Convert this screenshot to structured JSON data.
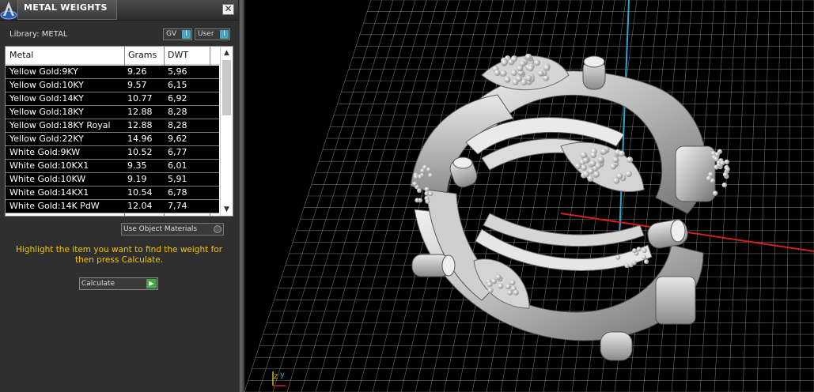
{
  "panel": {
    "title": "METAL WEIGHTS",
    "close_glyph": "✕",
    "library_label": "Library: METAL",
    "gv_label": "GV",
    "user_label": "User",
    "toggle_glyph": "I",
    "columns": [
      "Metal",
      "Grams",
      "DWT"
    ],
    "rows": [
      {
        "metal": "Yellow Gold:9KY",
        "grams": "9.26",
        "dwt": "5,96"
      },
      {
        "metal": "Yellow Gold:10KY",
        "grams": "9.57",
        "dwt": "6,15"
      },
      {
        "metal": "Yellow Gold:14KY",
        "grams": "10.77",
        "dwt": "6,92"
      },
      {
        "metal": "Yellow Gold:18KY",
        "grams": "12.88",
        "dwt": "8,28"
      },
      {
        "metal": "Yellow Gold:18KY Royal",
        "grams": "12.88",
        "dwt": "8,28"
      },
      {
        "metal": "Yellow Gold:22KY",
        "grams": "14.96",
        "dwt": "9,62"
      },
      {
        "metal": "White Gold:9KW",
        "grams": "10.52",
        "dwt": "6,77"
      },
      {
        "metal": "White Gold:10KX1",
        "grams": "9.35",
        "dwt": "6,01"
      },
      {
        "metal": "White Gold:10KW",
        "grams": "9.19",
        "dwt": "5,91"
      },
      {
        "metal": "White Gold:14KX1",
        "grams": "10.54",
        "dwt": "6,78"
      },
      {
        "metal": "White Gold:14K PdW",
        "grams": "12.04",
        "dwt": "7,74"
      }
    ],
    "use_object_materials": "Use Object Materials",
    "hint": "Highlight the item you want to find the weight for then press Calculate.",
    "calculate_label": "Calculate",
    "hint_color": "#f5c400"
  },
  "viewport": {
    "axis_label_z": "z",
    "axis_label_y": "y",
    "grid_color": "#9a9a9a",
    "x_axis_color": "#d42020",
    "y_axis_color": "#2aa6c8"
  }
}
